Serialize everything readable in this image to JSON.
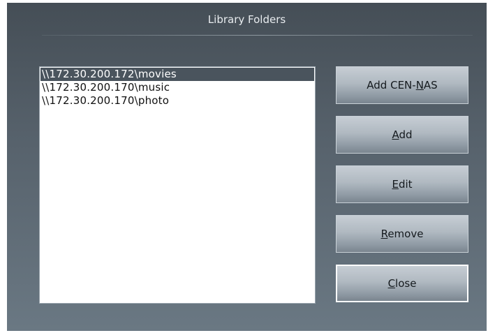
{
  "dialog": {
    "title": "Library Folders"
  },
  "folders": [
    {
      "path": "\\\\172.30.200.172\\movies",
      "selected": true
    },
    {
      "path": "\\\\172.30.200.170\\music",
      "selected": false
    },
    {
      "path": "\\\\172.30.200.170\\photo",
      "selected": false
    }
  ],
  "buttons": {
    "add_cen_nas": {
      "before": "Add CEN-",
      "mnemonic": "N",
      "after": "AS"
    },
    "add": {
      "before": "",
      "mnemonic": "A",
      "after": "dd"
    },
    "edit": {
      "before": "",
      "mnemonic": "E",
      "after": "dit"
    },
    "remove": {
      "before": "",
      "mnemonic": "R",
      "after": "emove"
    },
    "close": {
      "before": "",
      "mnemonic": "C",
      "after": "lose"
    }
  }
}
